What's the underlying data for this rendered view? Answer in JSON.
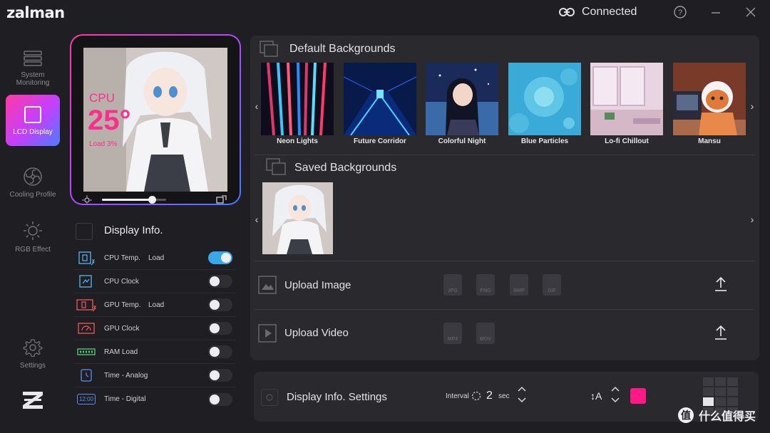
{
  "app": {
    "logo": "zalman"
  },
  "titlebar": {
    "connection_status": "Connected"
  },
  "nav": [
    {
      "label": "System Monitoring",
      "icon": "system-monitoring-icon",
      "active": false
    },
    {
      "label": "LCD Display",
      "icon": "lcd-display-icon",
      "active": true
    },
    {
      "label": "Cooling Profile",
      "icon": "fan-icon",
      "active": false
    },
    {
      "label": "RGB Effect",
      "icon": "sun-icon",
      "active": false
    },
    {
      "label": "Settings",
      "icon": "gear-icon",
      "active": false
    }
  ],
  "preview": {
    "overlay_label": "CPU",
    "overlay_value": "25°",
    "overlay_sub": "Load 3%",
    "brightness_fraction": 0.78
  },
  "display_info": {
    "title": "Display Info.",
    "items": [
      {
        "label": "CPU Temp.",
        "sub": "Load",
        "icon": "cpu-temp-icon",
        "on": true
      },
      {
        "label": "CPU Clock",
        "sub": "",
        "icon": "cpu-clock-icon",
        "on": false
      },
      {
        "label": "GPU Temp.",
        "sub": "Load",
        "icon": "gpu-temp-icon",
        "on": false
      },
      {
        "label": "GPU Clock",
        "sub": "",
        "icon": "gpu-clock-icon",
        "on": false
      },
      {
        "label": "RAM Load",
        "sub": "",
        "icon": "ram-icon",
        "on": false
      },
      {
        "label": "Time - Analog",
        "sub": "",
        "icon": "clock-analog-icon",
        "on": false
      },
      {
        "label": "Time - Digital",
        "sub": "",
        "icon": "clock-digital-icon",
        "on": false
      }
    ],
    "digital_icon_text": "12:00"
  },
  "default_backgrounds": {
    "title": "Default Backgrounds",
    "items": [
      {
        "label": "Neon Lights"
      },
      {
        "label": "Future Corridor"
      },
      {
        "label": "Colorful Night"
      },
      {
        "label": "Blue Particles"
      },
      {
        "label": "Lo-fi Chillout"
      },
      {
        "label": "Mansu"
      }
    ]
  },
  "saved_backgrounds": {
    "title": "Saved Backgrounds"
  },
  "upload_image": {
    "title": "Upload Image",
    "formats": [
      "JPG",
      "PNG",
      "BMP",
      "GIF"
    ]
  },
  "upload_video": {
    "title": "Upload Video",
    "formats": [
      "MP4",
      "MOV"
    ]
  },
  "display_settings": {
    "title": "Display Info. Settings",
    "interval_label": "Interval",
    "interval_value": "2",
    "interval_unit": "sec",
    "font_size_glyph": "↕A",
    "color": "#ff1a86"
  },
  "watermark": {
    "text": "什么值得买"
  },
  "colors": {
    "accent_pink": "#ff3aa5",
    "accent_blue": "#3f7dff",
    "toggle_on": "#39a8e8"
  }
}
